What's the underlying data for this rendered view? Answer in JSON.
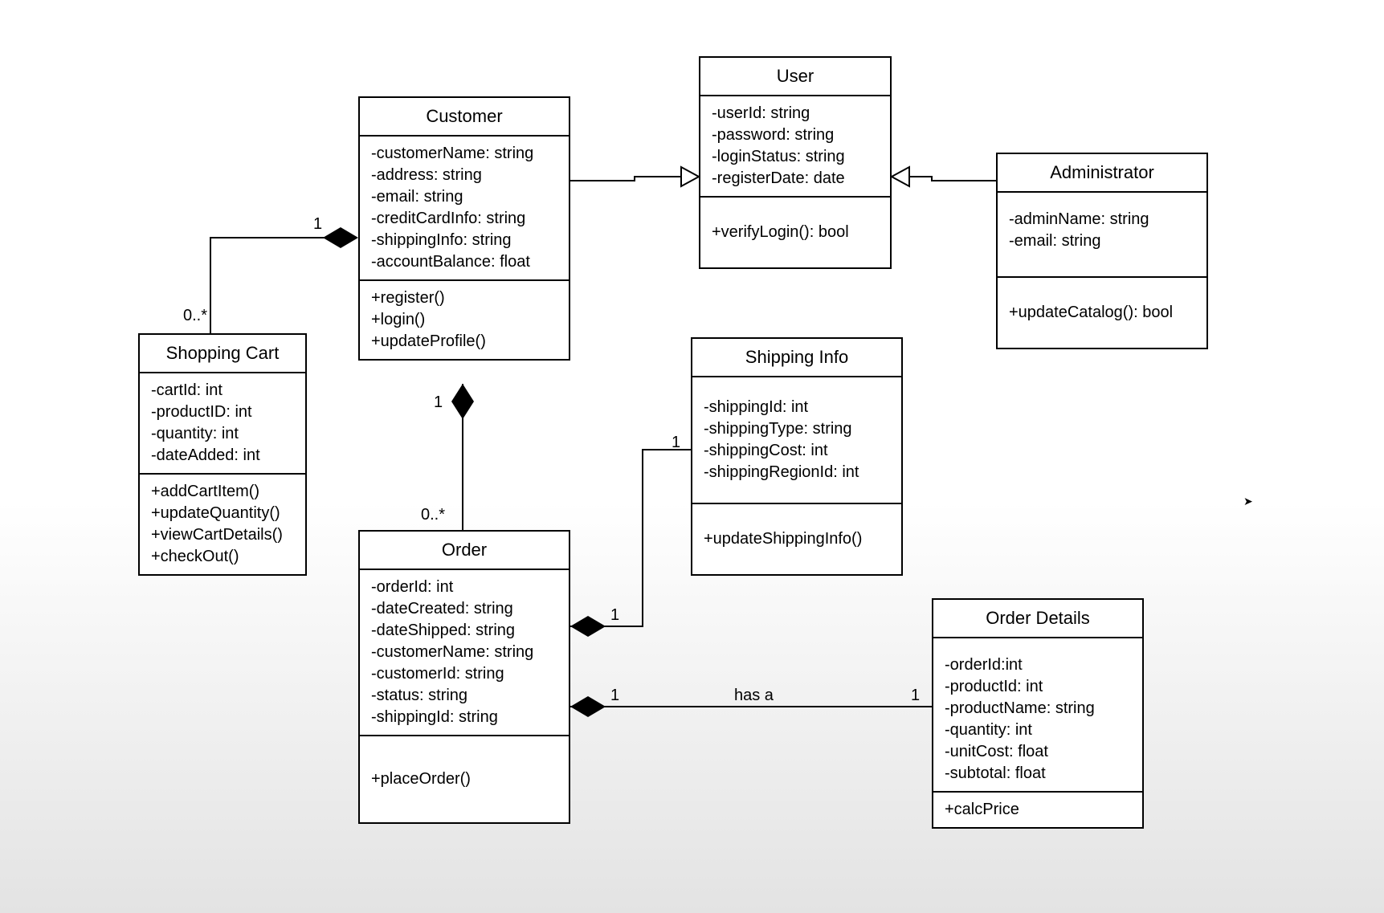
{
  "classes": {
    "user": {
      "name": "User",
      "attrs": [
        "-userId: string",
        "-password: string",
        "-loginStatus: string",
        "-registerDate: date"
      ],
      "ops": [
        "+verifyLogin(): bool"
      ]
    },
    "customer": {
      "name": "Customer",
      "attrs": [
        "-customerName: string",
        "-address: string",
        "-email: string",
        "-creditCardInfo: string",
        "-shippingInfo: string",
        "-accountBalance: float"
      ],
      "ops": [
        "+register()",
        "+login()",
        "+updateProfile()"
      ]
    },
    "administrator": {
      "name": "Administrator",
      "attrs": [
        "-adminName: string",
        "-email: string"
      ],
      "ops": [
        "+updateCatalog(): bool"
      ]
    },
    "shoppingCart": {
      "name": "Shopping Cart",
      "attrs": [
        "-cartId: int",
        "-productID: int",
        "-quantity: int",
        "-dateAdded: int"
      ],
      "ops": [
        "+addCartItem()",
        "+updateQuantity()",
        "+viewCartDetails()",
        "+checkOut()"
      ]
    },
    "order": {
      "name": "Order",
      "attrs": [
        "-orderId: int",
        "-dateCreated: string",
        "-dateShipped: string",
        "-customerName: string",
        "-customerId: string",
        "-status: string",
        "-shippingId: string"
      ],
      "ops": [
        "+placeOrder()"
      ]
    },
    "shippingInfo": {
      "name": "Shipping Info",
      "attrs": [
        "-shippingId: int",
        "-shippingType: string",
        "-shippingCost: int",
        "-shippingRegionId: int"
      ],
      "ops": [
        "+updateShippingInfo()"
      ]
    },
    "orderDetails": {
      "name": "Order Details",
      "attrs": [
        "-orderId:int",
        "-productId: int",
        "-productName: string",
        "-quantity: int",
        "-unitCost: float",
        "-subtotal: float"
      ],
      "ops": [
        "+calcPrice"
      ]
    }
  },
  "labels": {
    "custCart1": "1",
    "custCartMany": "0..*",
    "custOrder1": "1",
    "custOrderMany": "0..*",
    "orderShip1a": "1",
    "orderShip1b": "1",
    "orderDet1a": "1",
    "orderDet1b": "1",
    "hasA": "has a"
  }
}
